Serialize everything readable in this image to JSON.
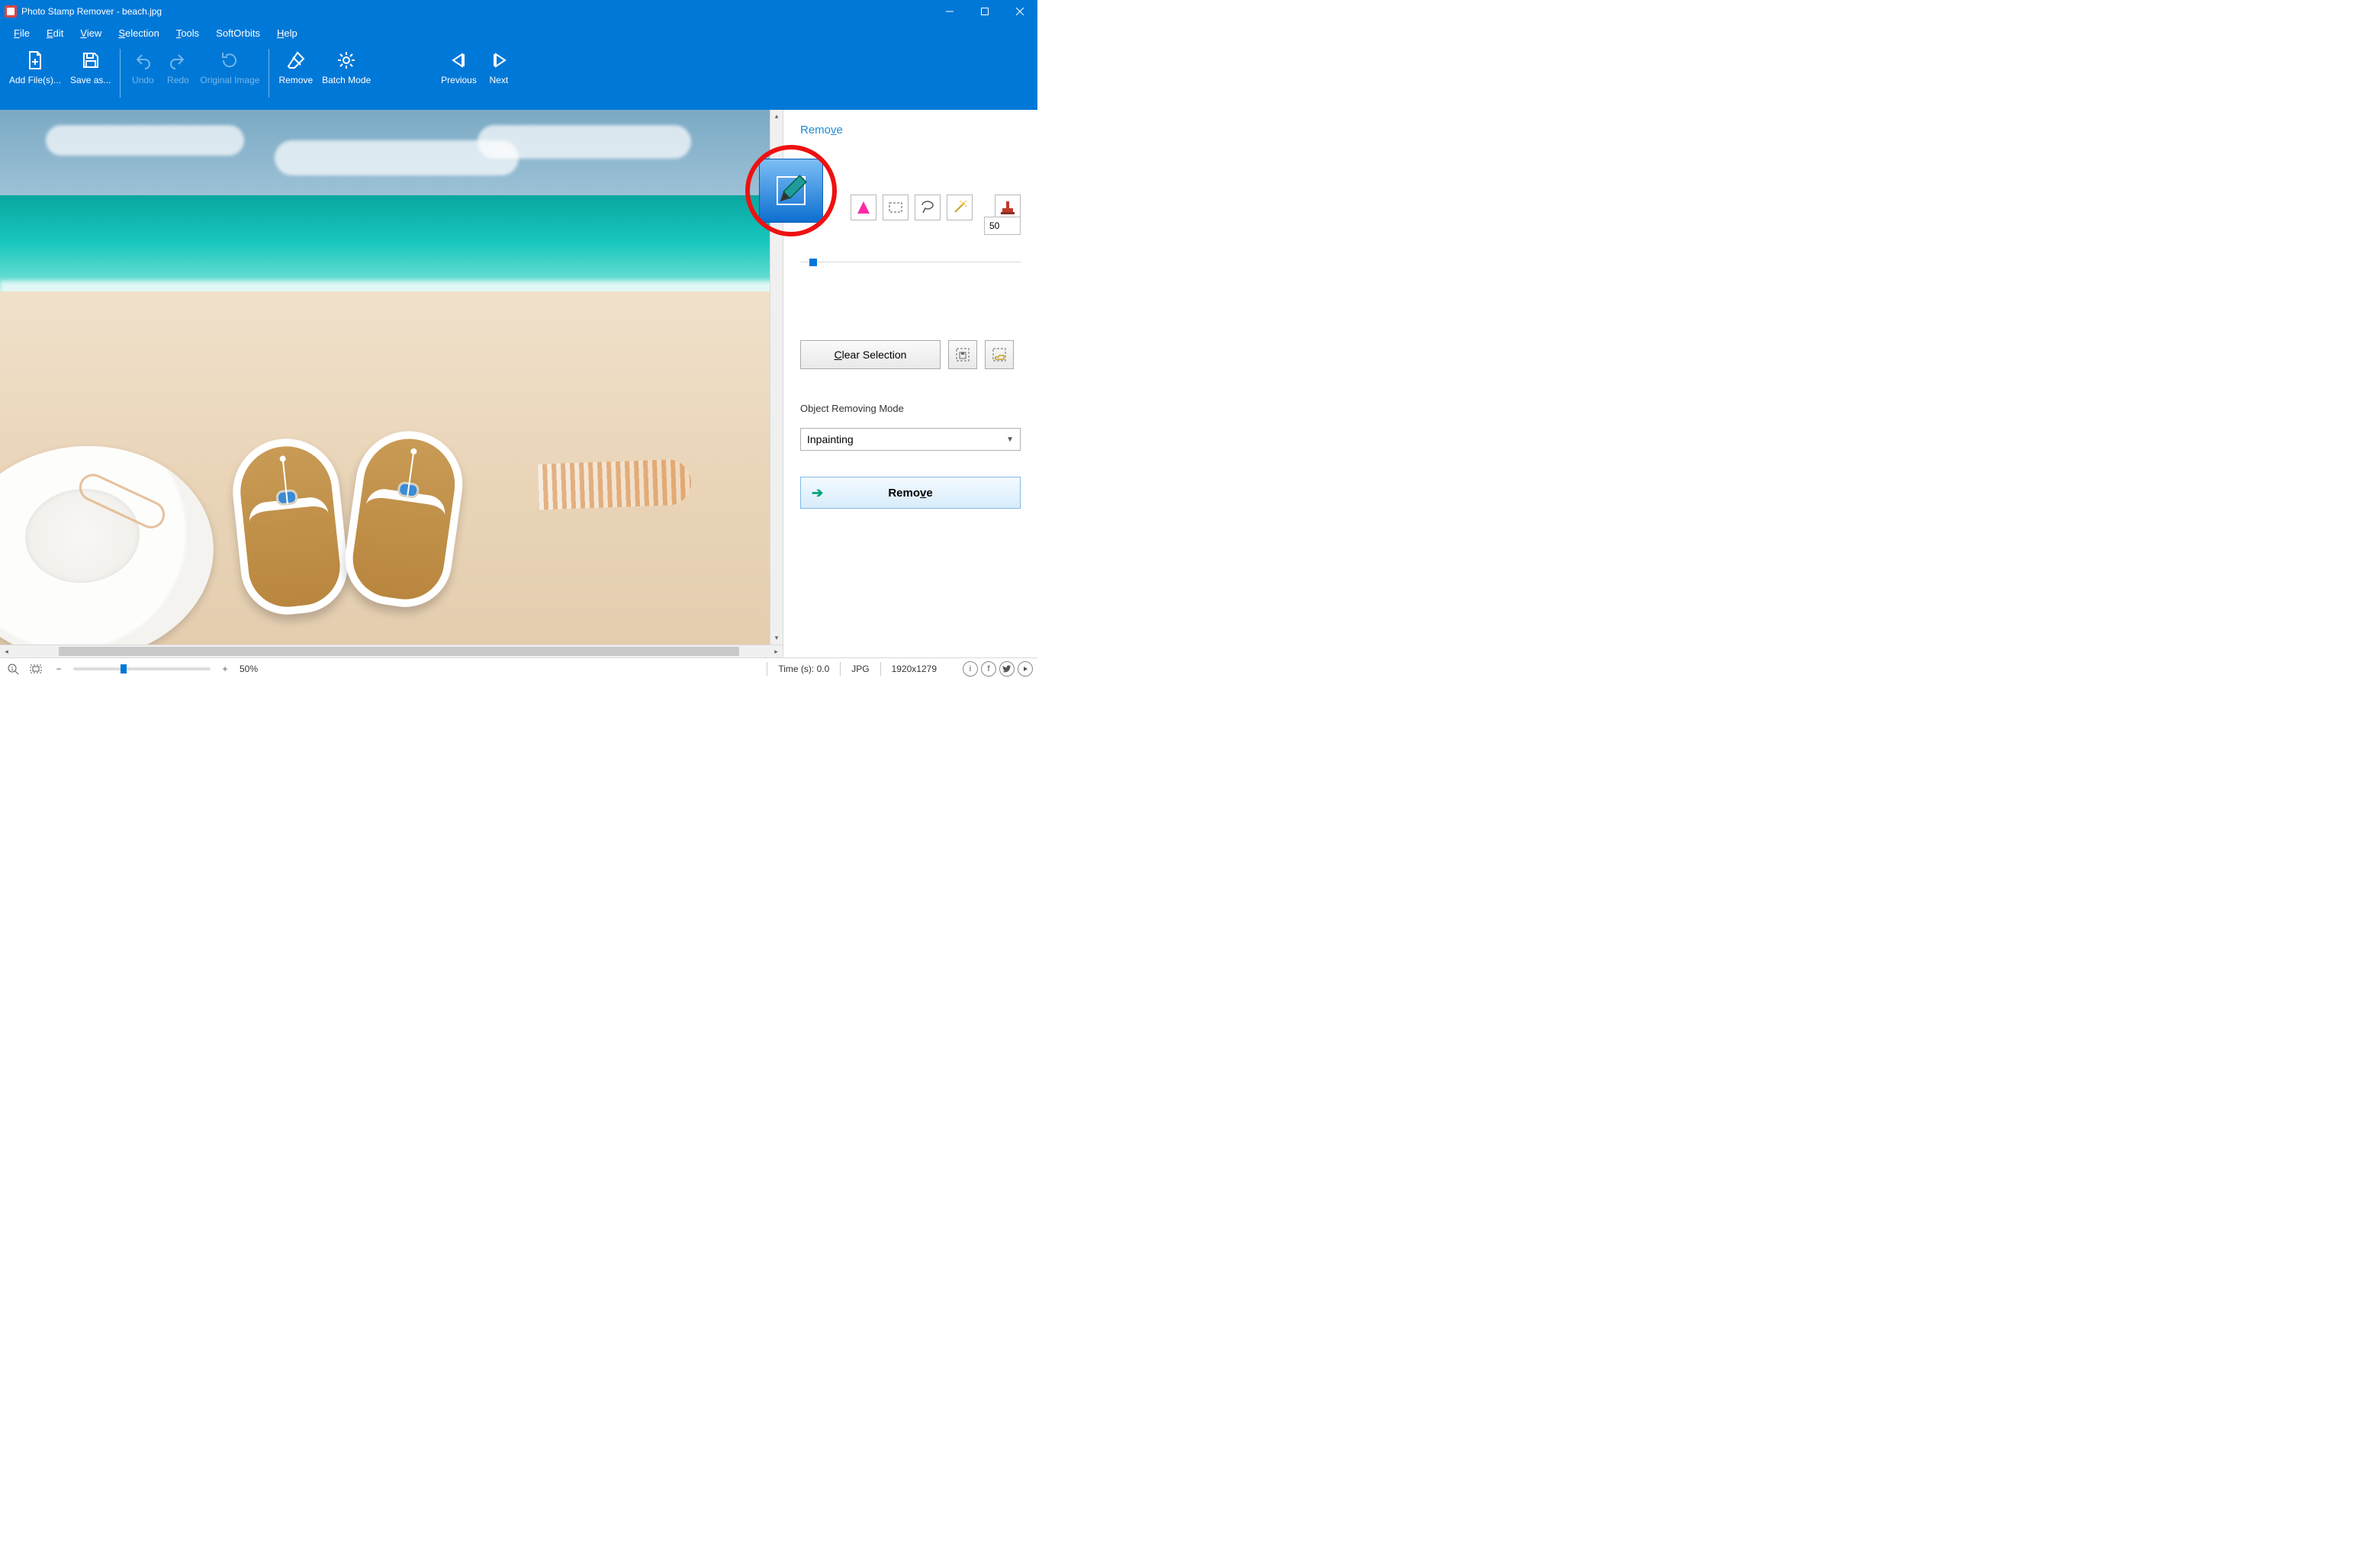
{
  "title": "Photo Stamp Remover - beach.jpg",
  "menu": {
    "file": "File",
    "edit": "Edit",
    "view": "View",
    "selection": "Selection",
    "tools": "Tools",
    "softorbits": "SoftOrbits",
    "help": "Help"
  },
  "toolbar": {
    "addfiles": "Add File(s)...",
    "saveas": "Save as...",
    "undo": "Undo",
    "redo": "Redo",
    "original": "Original Image",
    "remove": "Remove",
    "batch": "Batch Mode",
    "previous": "Previous",
    "next": "Next"
  },
  "panel": {
    "tab": "Remove",
    "size": "50",
    "clear": "Clear Selection",
    "mode_label": "Object Removing Mode",
    "mode_value": "Inpainting",
    "remove": "Remove"
  },
  "status": {
    "zoom": "50%",
    "time": "Time (s): 0.0",
    "format": "JPG",
    "dims": "1920x1279"
  }
}
